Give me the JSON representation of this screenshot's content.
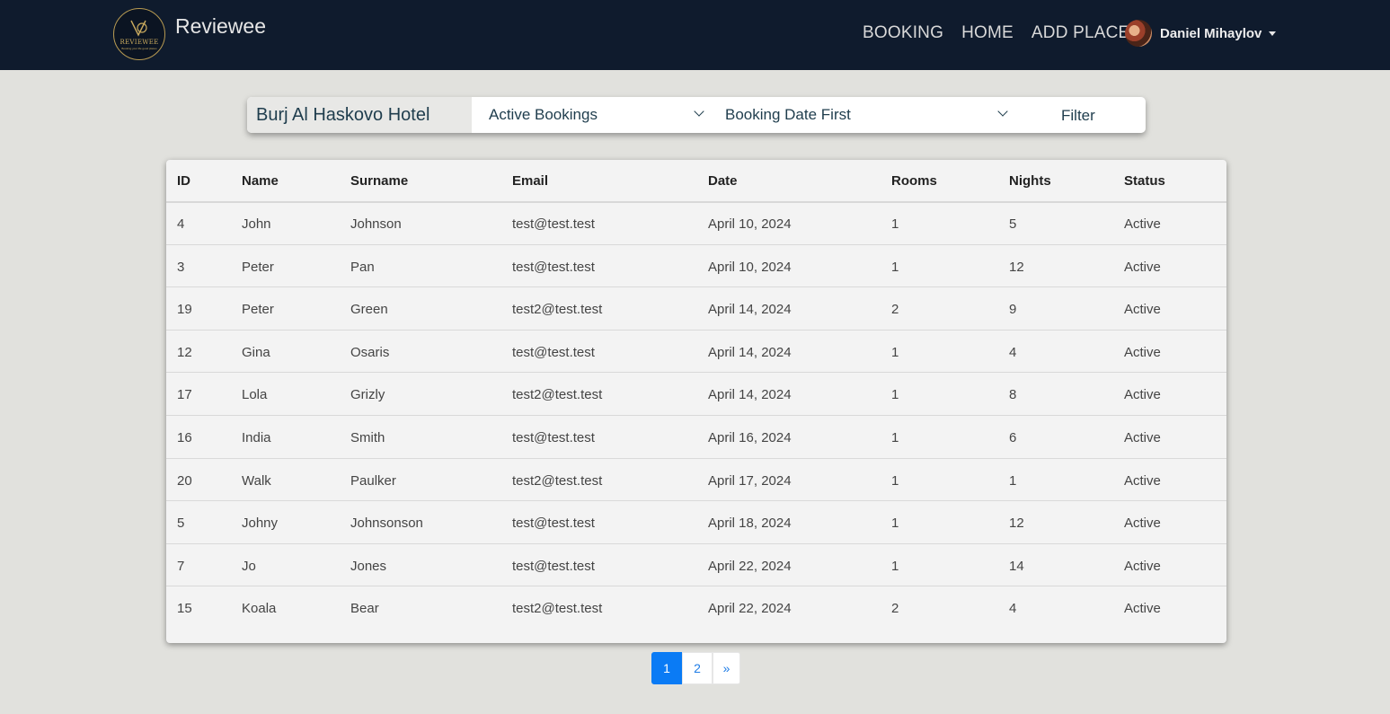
{
  "navbar": {
    "brand": "Reviewee",
    "logo_text": "REVIEWEE",
    "logo_subtext": "Booking your life good places",
    "links": [
      "BOOKING",
      "HOME",
      "ADD PLACE"
    ],
    "user_name": "Daniel Mihaylov"
  },
  "filter": {
    "hotel_name": "Burj Al Haskovo Hotel",
    "status_select": "Active Bookings",
    "order_select": "Booking Date First",
    "filter_button": "Filter"
  },
  "table": {
    "headers": [
      "ID",
      "Name",
      "Surname",
      "Email",
      "Date",
      "Rooms",
      "Nights",
      "Status"
    ],
    "rows": [
      [
        "4",
        "John",
        "Johnson",
        "test@test.test",
        "April 10, 2024",
        "1",
        "5",
        "Active"
      ],
      [
        "3",
        "Peter",
        "Pan",
        "test@test.test",
        "April 10, 2024",
        "1",
        "12",
        "Active"
      ],
      [
        "19",
        "Peter",
        "Green",
        "test2@test.test",
        "April 14, 2024",
        "2",
        "9",
        "Active"
      ],
      [
        "12",
        "Gina",
        "Osaris",
        "test@test.test",
        "April 14, 2024",
        "1",
        "4",
        "Active"
      ],
      [
        "17",
        "Lola",
        "Grizly",
        "test2@test.test",
        "April 14, 2024",
        "1",
        "8",
        "Active"
      ],
      [
        "16",
        "India",
        "Smith",
        "test@test.test",
        "April 16, 2024",
        "1",
        "6",
        "Active"
      ],
      [
        "20",
        "Walk",
        "Paulker",
        "test2@test.test",
        "April 17, 2024",
        "1",
        "1",
        "Active"
      ],
      [
        "5",
        "Johny",
        "Johnsonson",
        "test@test.test",
        "April 18, 2024",
        "1",
        "12",
        "Active"
      ],
      [
        "7",
        "Jo",
        "Jones",
        "test@test.test",
        "April 22, 2024",
        "1",
        "14",
        "Active"
      ],
      [
        "15",
        "Koala",
        "Bear",
        "test2@test.test",
        "April 22, 2024",
        "2",
        "4",
        "Active"
      ]
    ]
  },
  "pagination": {
    "pages": [
      "1",
      "2"
    ],
    "next": "»",
    "active_page": "1"
  },
  "colors": {
    "navbar_bg": "#0f1b2d",
    "page_bg": "#e1e1dd",
    "accent": "#0a7bf5",
    "logo_gold": "#c9aa5e"
  }
}
